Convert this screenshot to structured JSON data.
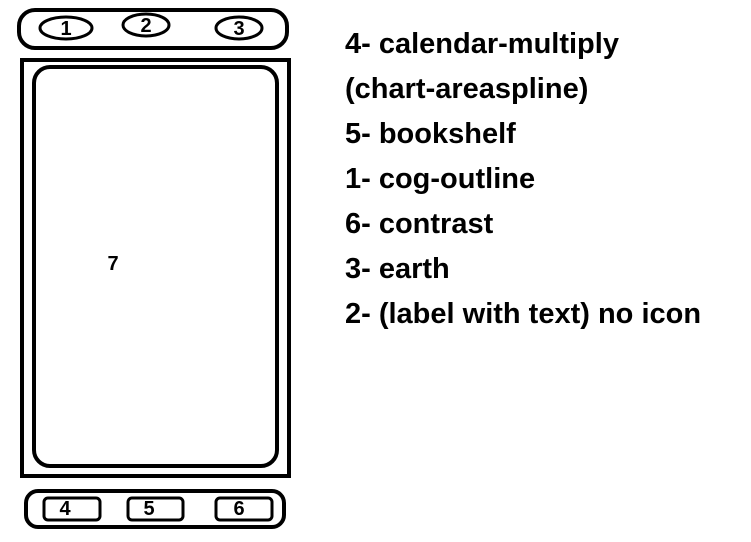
{
  "wireframe": {
    "top_bar_slots": [
      "1",
      "2",
      "3"
    ],
    "content_area_number": "7",
    "bottom_bar_slots": [
      "4",
      "5",
      "6"
    ]
  },
  "legend": [
    "4- calendar-multiply",
    "(chart-areaspline)",
    "5- bookshelf",
    "1- cog-outline",
    "6- contrast",
    "3- earth",
    "2- (label with text) no icon"
  ],
  "colors": {
    "ink": "#000000",
    "paper": "#ffffff"
  }
}
